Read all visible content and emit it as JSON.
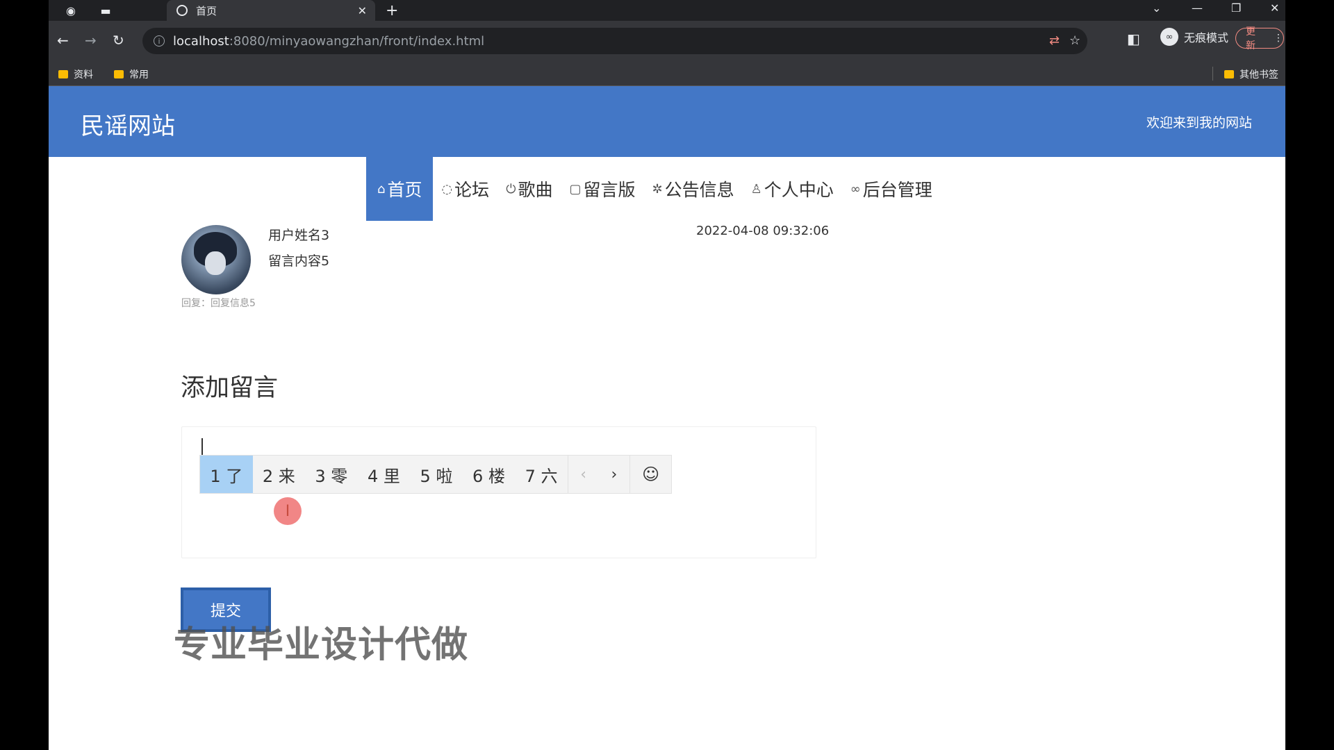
{
  "browser": {
    "tab_title": "首页",
    "url_host": "localhost",
    "url_rest": ":8080/minyaowangzhan/front/index.html",
    "incognito_label": "无痕模式",
    "update_label": "更新",
    "bookmarks": [
      "资料",
      "常用"
    ],
    "other_bookmarks": "其他书签"
  },
  "site": {
    "title": "民谣网站",
    "welcome": "欢迎来到我的网站"
  },
  "nav": [
    {
      "label": "首页",
      "icon": "home-icon"
    },
    {
      "label": "论坛",
      "icon": "chat-icon"
    },
    {
      "label": "歌曲",
      "icon": "power-icon"
    },
    {
      "label": "留言版",
      "icon": "note-icon"
    },
    {
      "label": "公告信息",
      "icon": "bell-icon"
    },
    {
      "label": "个人中心",
      "icon": "user-icon"
    },
    {
      "label": "后台管理",
      "icon": "link-icon"
    }
  ],
  "message": {
    "user_name": "用户姓名3",
    "content": "留言内容5",
    "time": "2022-04-08 09:32:06",
    "reply": "回复：回复信息5"
  },
  "form": {
    "section_title": "添加留言",
    "submit_label": "提交"
  },
  "ime": {
    "candidates": [
      "1 了",
      "2 来",
      "3 零",
      "4 里",
      "5 啦",
      "6 楼",
      "7 六"
    ]
  },
  "watermark": "专业毕业设计代做"
}
